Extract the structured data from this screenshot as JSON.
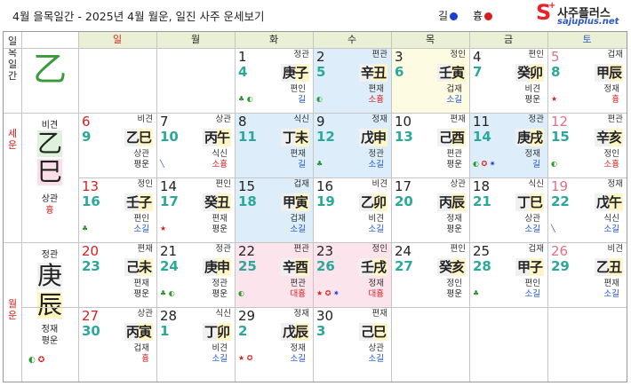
{
  "header": {
    "title": "4월 을목일간 - 2025년 4월 월운, 일진 사주 운세보기",
    "legend_gil": "길",
    "legend_hung": "흉",
    "gil_color": "#1a3fd6",
    "hung_color": "#d61e1e",
    "logo_text": "사주플러스",
    "logo_url": "sajuplus.net"
  },
  "weekdays": [
    "일",
    "월",
    "화",
    "수",
    "목",
    "금",
    "토"
  ],
  "left": {
    "il": [
      "일",
      "목",
      "일",
      "간"
    ],
    "il_gan": "乙",
    "se": [
      "세",
      "운"
    ],
    "se_top": "비견",
    "se_gan": "乙",
    "se_ji": "巳",
    "se_bottom": "상관",
    "se_bottom2": "흉",
    "wol": [
      "월",
      "운"
    ],
    "wol_top": "정관",
    "wol_gan": "庚",
    "wol_ji": "辰",
    "wol_bottom": "정재",
    "wol_bottom2": "평운"
  },
  "days": [
    {
      "d": "1",
      "l": "4",
      "t": "정관",
      "g": "庚子",
      "b": "편인",
      "c": "길",
      "cls": "gil",
      "icons": "♣ ◐"
    },
    {
      "d": "2",
      "l": "5",
      "t": "편관",
      "g": "辛丑",
      "b": "편재",
      "c": "소흉",
      "cls": "hung",
      "icons": "◐"
    },
    {
      "d": "3",
      "l": "6",
      "t": "정인",
      "g": "壬寅",
      "b": "겁재",
      "c": "소길",
      "cls": "gil",
      "icons": ""
    },
    {
      "d": "4",
      "l": "7",
      "t": "편인",
      "g": "癸卯",
      "b": "비견",
      "c": "평운",
      "cls": "",
      "icons": ""
    },
    {
      "d": "5",
      "l": "8",
      "t": "겁재",
      "g": "甲辰",
      "b": "정재",
      "c": "흉",
      "cls": "hung",
      "icons": "★"
    },
    {
      "d": "6",
      "l": "9",
      "t": "비견",
      "g": "乙巳",
      "b": "상관",
      "c": "평운",
      "cls": "",
      "icons": ""
    },
    {
      "d": "7",
      "l": "10",
      "t": "상관",
      "g": "丙午",
      "b": "식신",
      "c": "소흉",
      "cls": "hung",
      "icons": "╲"
    },
    {
      "d": "8",
      "l": "11",
      "t": "식신",
      "g": "丁未",
      "b": "편재",
      "c": "길",
      "cls": "gil",
      "icons": ""
    },
    {
      "d": "9",
      "l": "12",
      "t": "정재",
      "g": "戊申",
      "b": "정관",
      "c": "소길",
      "cls": "gil",
      "icons": "♣"
    },
    {
      "d": "10",
      "l": "13",
      "t": "편재",
      "g": "己酉",
      "b": "편관",
      "c": "평운",
      "cls": "",
      "icons": ""
    },
    {
      "d": "11",
      "l": "14",
      "t": "정관",
      "g": "庚戌",
      "b": "정재",
      "c": "길",
      "cls": "gil",
      "icons": "◐ ✪ ✷"
    },
    {
      "d": "12",
      "l": "15",
      "t": "편관",
      "g": "辛亥",
      "b": "정인",
      "c": "소흉",
      "cls": "hung",
      "icons": "◐"
    },
    {
      "d": "13",
      "l": "16",
      "t": "정인",
      "g": "壬子",
      "b": "편인",
      "c": "소길",
      "cls": "gil",
      "icons": "♣"
    },
    {
      "d": "14",
      "l": "17",
      "t": "편인",
      "g": "癸丑",
      "b": "편재",
      "c": "평운",
      "cls": "",
      "icons": "★"
    },
    {
      "d": "15",
      "l": "18",
      "t": "겁재",
      "g": "甲寅",
      "b": "겁재",
      "c": "소길",
      "cls": "gil",
      "icons": ""
    },
    {
      "d": "16",
      "l": "19",
      "t": "비견",
      "g": "乙卯",
      "b": "비견",
      "c": "소길",
      "cls": "gil",
      "icons": ""
    },
    {
      "d": "17",
      "l": "20",
      "t": "상관",
      "g": "丙辰",
      "b": "정재",
      "c": "평운",
      "cls": "",
      "icons": ""
    },
    {
      "d": "18",
      "l": "21",
      "t": "식신",
      "g": "丁巳",
      "b": "상관",
      "c": "소길",
      "cls": "gil",
      "icons": ""
    },
    {
      "d": "19",
      "l": "22",
      "t": "정재",
      "g": "戊午",
      "b": "식신",
      "c": "소길",
      "cls": "gil",
      "icons": "╲"
    },
    {
      "d": "20",
      "l": "23",
      "t": "편재",
      "g": "己未",
      "b": "편재",
      "c": "평운",
      "cls": "",
      "icons": ""
    },
    {
      "d": "21",
      "l": "24",
      "t": "정관",
      "g": "庚申",
      "b": "정관",
      "c": "평운",
      "cls": "",
      "icons": "♣ ◐"
    },
    {
      "d": "22",
      "l": "25",
      "t": "편관",
      "g": "辛酉",
      "b": "편관",
      "c": "대흉",
      "cls": "hung",
      "icons": "◐"
    },
    {
      "d": "23",
      "l": "26",
      "t": "정인",
      "g": "壬戌",
      "b": "정재",
      "c": "대흉",
      "cls": "hung",
      "icons": "★ ✪ ✷"
    },
    {
      "d": "24",
      "l": "27",
      "t": "편인",
      "g": "癸亥",
      "b": "정인",
      "c": "평운",
      "cls": "",
      "icons": ""
    },
    {
      "d": "25",
      "l": "28",
      "t": "겁재",
      "g": "甲子",
      "b": "편인",
      "c": "소길",
      "cls": "gil",
      "icons": "♣"
    },
    {
      "d": "26",
      "l": "29",
      "t": "비견",
      "g": "乙丑",
      "b": "편재",
      "c": "소길",
      "cls": "gil",
      "icons": ""
    },
    {
      "d": "27",
      "l": "30",
      "t": "상관",
      "g": "丙寅",
      "b": "겁재",
      "c": "흉",
      "cls": "hung",
      "icons": ""
    },
    {
      "d": "28",
      "l": "1",
      "t": "식신",
      "g": "丁卯",
      "b": "비견",
      "c": "소길",
      "cls": "gil",
      "icons": ""
    },
    {
      "d": "29",
      "l": "2",
      "t": "정재",
      "g": "戊辰",
      "b": "정재",
      "c": "소길",
      "cls": "gil",
      "icons": "★ ✪"
    },
    {
      "d": "30",
      "l": "3",
      "t": "편재",
      "g": "己巳",
      "b": "상관",
      "c": "소길",
      "cls": "gil",
      "icons": ""
    }
  ]
}
